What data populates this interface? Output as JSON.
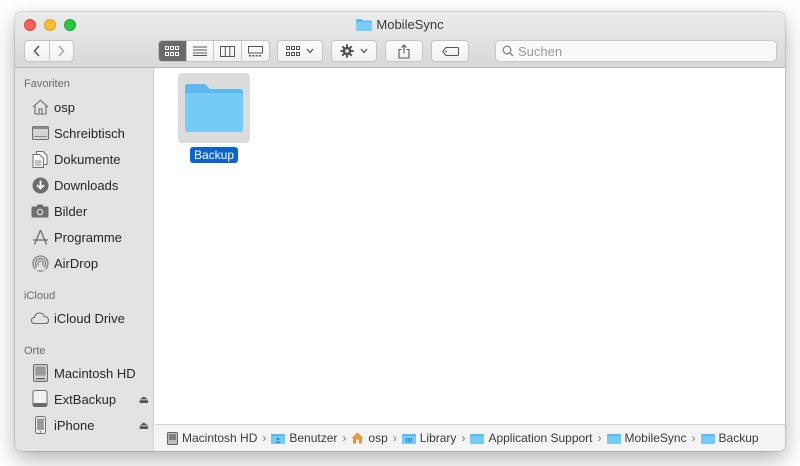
{
  "window": {
    "title": "MobileSync"
  },
  "toolbar": {
    "back_icon": "chevron-left-icon",
    "forward_icon": "chevron-right-icon",
    "view_modes": [
      "icon-view",
      "list-view",
      "column-view",
      "gallery-view"
    ],
    "active_view": "icon-view",
    "group_icon": "grid-menu-icon",
    "action_icon": "gear-icon",
    "share_icon": "share-icon",
    "tag_icon": "tag-icon"
  },
  "search": {
    "placeholder": "Suchen"
  },
  "sidebar": {
    "sections": [
      {
        "title": "Favoriten",
        "items": [
          {
            "label": "osp",
            "icon": "home-icon"
          },
          {
            "label": "Schreibtisch",
            "icon": "desktop-icon"
          },
          {
            "label": "Dokumente",
            "icon": "document-icon"
          },
          {
            "label": "Downloads",
            "icon": "download-icon"
          },
          {
            "label": "Bilder",
            "icon": "camera-icon"
          },
          {
            "label": "Programme",
            "icon": "apps-icon"
          },
          {
            "label": "AirDrop",
            "icon": "airdrop-icon"
          }
        ]
      },
      {
        "title": "iCloud",
        "items": [
          {
            "label": "iCloud Drive",
            "icon": "cloud-icon"
          }
        ]
      },
      {
        "title": "Orte",
        "items": [
          {
            "label": "Macintosh HD",
            "icon": "harddisk-icon"
          },
          {
            "label": "ExtBackup",
            "icon": "external-disk-icon",
            "eject": "⏏"
          },
          {
            "label": "iPhone",
            "icon": "phone-icon",
            "eject": "⏏"
          }
        ]
      }
    ]
  },
  "files": [
    {
      "name": "Backup",
      "type": "folder",
      "selected": true
    }
  ],
  "pathbar": {
    "crumbs": [
      "Macintosh HD",
      "Benutzer",
      "osp",
      "Library",
      "Application Support",
      "MobileSync",
      "Backup"
    ],
    "separator": "›"
  },
  "colors": {
    "accent": "#0a63d0",
    "folder": "#6ec6f5",
    "sidebar_bg": "#e3e3e3"
  }
}
